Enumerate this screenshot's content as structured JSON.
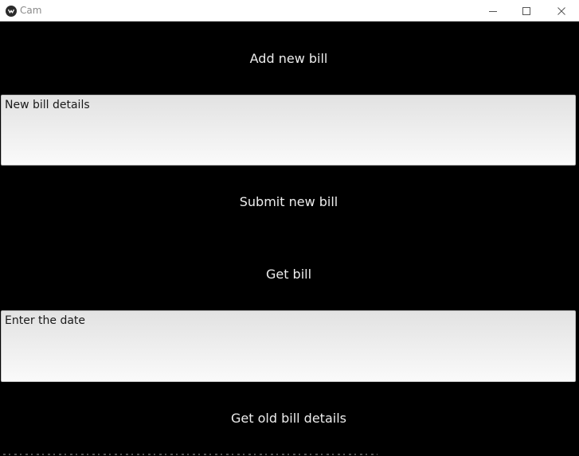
{
  "window": {
    "title": "Cam",
    "app_icon": "kivy-logo-icon",
    "controls": {
      "minimize": "minimize-icon",
      "maximize": "maximize-icon",
      "close": "close-icon"
    }
  },
  "main": {
    "add_bill_button": "Add new bill",
    "new_bill_field": {
      "value": "",
      "placeholder": "New bill details"
    },
    "submit_bill_button": "Submit new bill",
    "get_bill_button": "Get bill",
    "date_field": {
      "value": "",
      "placeholder": "Enter the date"
    },
    "get_old_bill_button": "Get old bill details"
  },
  "colors": {
    "background": "#000000",
    "button_text": "#ededed",
    "field_top": "#e2e2e2",
    "field_bottom": "#fafafa",
    "titlebar": "#ffffff"
  }
}
